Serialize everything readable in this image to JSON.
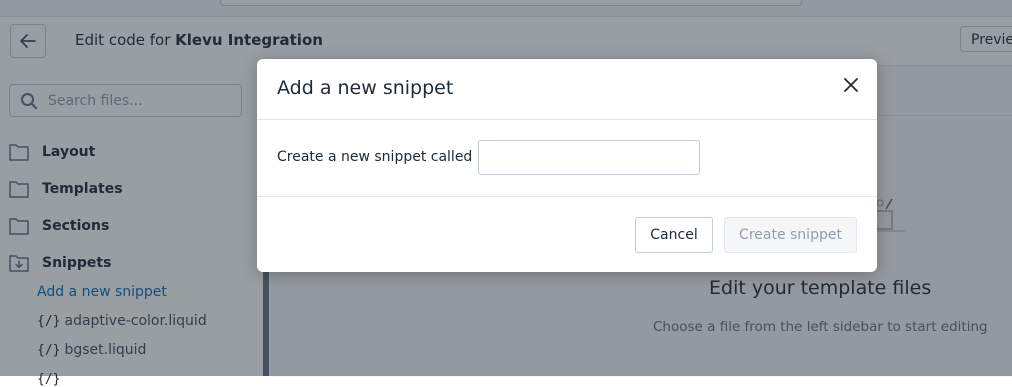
{
  "header": {
    "title_prefix": "Edit code for ",
    "theme_name": "Klevu Integration",
    "preview_label": "Previe"
  },
  "sidebar": {
    "search_placeholder": "Search files...",
    "folders": [
      {
        "label": "Layout",
        "icon": "folder-icon"
      },
      {
        "label": "Templates",
        "icon": "folder-icon"
      },
      {
        "label": "Sections",
        "icon": "folder-icon"
      },
      {
        "label": "Snippets",
        "icon": "folder-open-download-icon"
      }
    ],
    "add_snippet_link": "Add a new snippet",
    "file_glyph": "{/}",
    "files": [
      "adaptive-color.liquid",
      "bgset.liquid"
    ]
  },
  "main": {
    "empty_title": "Edit your template files",
    "empty_subtitle": "Choose a file from the left sidebar to start editing"
  },
  "modal": {
    "title": "Add a new snippet",
    "field_label": "Create a new snippet called",
    "input_value": "",
    "cancel_label": "Cancel",
    "create_label": "Create snippet"
  },
  "colors": {
    "link": "#006fbb",
    "overlay": "rgba(33,43,54,0.46)",
    "disabled_text": "#919eab"
  }
}
